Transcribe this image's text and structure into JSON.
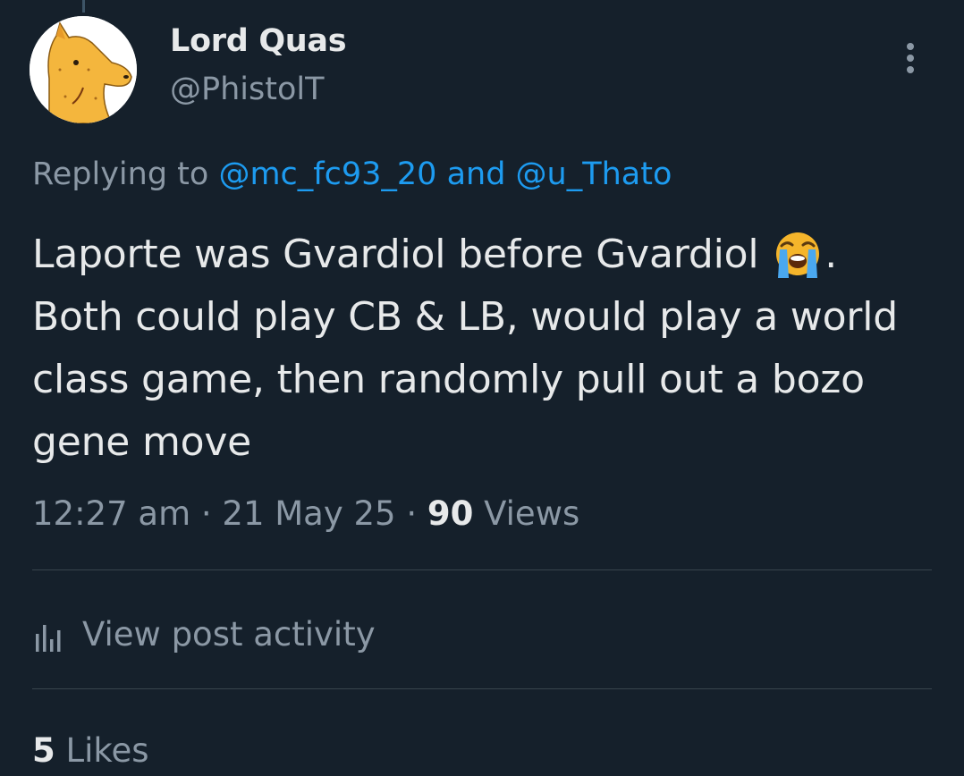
{
  "author": {
    "display_name": "Lord Quas",
    "handle": "@PhistolT"
  },
  "reply": {
    "prefix": "Replying to ",
    "mention_1": "@mc_fc93_20",
    "joiner": " and ",
    "mention_2": "@u_Thato"
  },
  "tweet": {
    "text_before_emoji": "Laporte was Gvardiol before Gvardiol ",
    "emoji": "loudly-crying-face",
    "text_after_emoji": ". Both could play CB & LB, would play a world class game, then randomly pull out a bozo gene move"
  },
  "meta": {
    "time": "12:27 am",
    "separator": " · ",
    "date": "21 May 25",
    "views_count": "90",
    "views_label": " Views"
  },
  "activity": {
    "label": "View post activity",
    "icon": "bar-chart-icon"
  },
  "likes": {
    "count": "5",
    "label": " Likes"
  },
  "colors": {
    "background": "#15202b",
    "text": "#e7e9ea",
    "muted": "#8b98a5",
    "link": "#1d9bf0",
    "divider": "#38444d"
  }
}
